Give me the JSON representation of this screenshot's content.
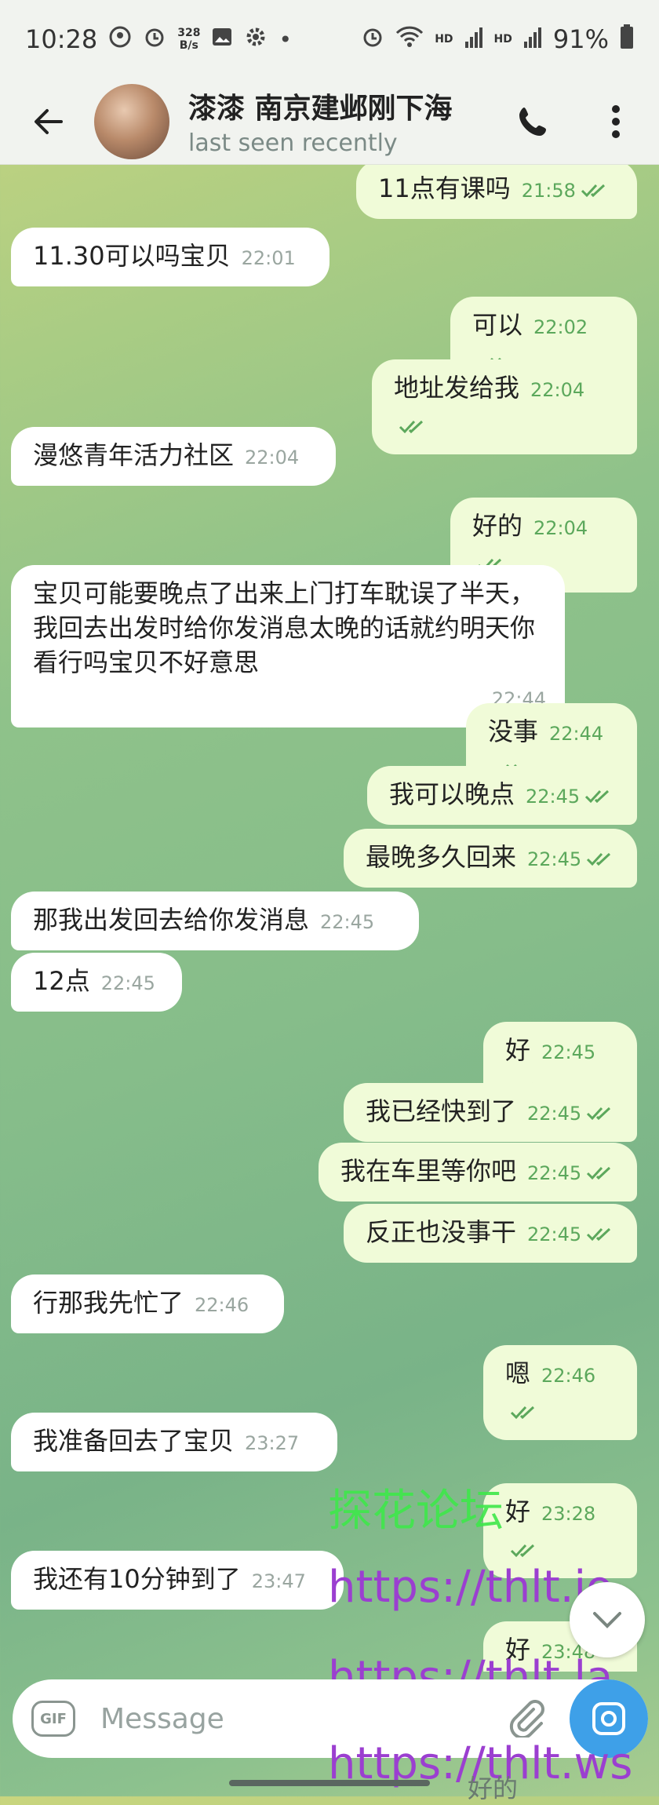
{
  "status_bar": {
    "time": "10:28",
    "net_speed_value": "328",
    "net_speed_unit": "B/s",
    "battery": "91%",
    "hd1": "HD",
    "hd2": "HD"
  },
  "header": {
    "name": "漆漆 南京建邺刚下海",
    "status": "last seen recently"
  },
  "messages": [
    {
      "dir": "out",
      "text": "11点有课吗",
      "time": "21:58",
      "read": true
    },
    {
      "dir": "in",
      "text": "11.30可以吗宝贝",
      "time": "22:01"
    },
    {
      "dir": "out",
      "text": "可以",
      "time": "22:02",
      "read": true
    },
    {
      "dir": "out",
      "text": "地址发给我",
      "time": "22:04",
      "read": true
    },
    {
      "dir": "in",
      "text": "漫悠青年活力社区",
      "time": "22:04"
    },
    {
      "dir": "out",
      "text": "好的",
      "time": "22:04",
      "read": true
    },
    {
      "dir": "in",
      "text": "宝贝可能要晚点了出来上门打车耽误了半天，我回去出发时给你发消息太晚的话就约明天你看行吗宝贝不好意思",
      "time": "22:44"
    },
    {
      "dir": "out",
      "text": "没事",
      "time": "22:44",
      "read": true
    },
    {
      "dir": "out",
      "text": "我可以晚点",
      "time": "22:45",
      "read": true
    },
    {
      "dir": "out",
      "text": "最晚多久回来",
      "time": "22:45",
      "read": true
    },
    {
      "dir": "in",
      "text": "那我出发回去给你发消息",
      "time": "22:45"
    },
    {
      "dir": "in",
      "text": "12点",
      "time": "22:45"
    },
    {
      "dir": "out",
      "text": "好",
      "time": "22:45",
      "read": true
    },
    {
      "dir": "out",
      "text": "我已经快到了",
      "time": "22:45",
      "read": true
    },
    {
      "dir": "out",
      "text": "我在车里等你吧",
      "time": "22:45",
      "read": true
    },
    {
      "dir": "out",
      "text": "反正也没事干",
      "time": "22:45",
      "read": true
    },
    {
      "dir": "in",
      "text": "行那我先忙了",
      "time": "22:46"
    },
    {
      "dir": "out",
      "text": "嗯",
      "time": "22:46",
      "read": true
    },
    {
      "dir": "in",
      "text": "我准备回去了宝贝",
      "time": "23:27"
    },
    {
      "dir": "out",
      "text": "好",
      "time": "23:28",
      "read": true
    },
    {
      "dir": "in",
      "text": "我还有10分钟到了",
      "time": "23:47"
    },
    {
      "dir": "out",
      "text": "好",
      "time": "23:48",
      "read": true
    }
  ],
  "partial_message": "好的",
  "watermarks": {
    "green": "探花论坛",
    "url1": "https://thlt.io",
    "url2": "https://thlt.la",
    "url3": "https://thlt.ws"
  },
  "input": {
    "gif_label": "GIF",
    "placeholder": "Message"
  },
  "colors": {
    "outgoing_bubble": "#f0fbd8",
    "incoming_bubble": "#ffffff",
    "read_check": "#5ca85c",
    "camera_button": "#3ea0e8",
    "watermark_url": "#9b3fd0",
    "watermark_green": "#3ee84a"
  }
}
